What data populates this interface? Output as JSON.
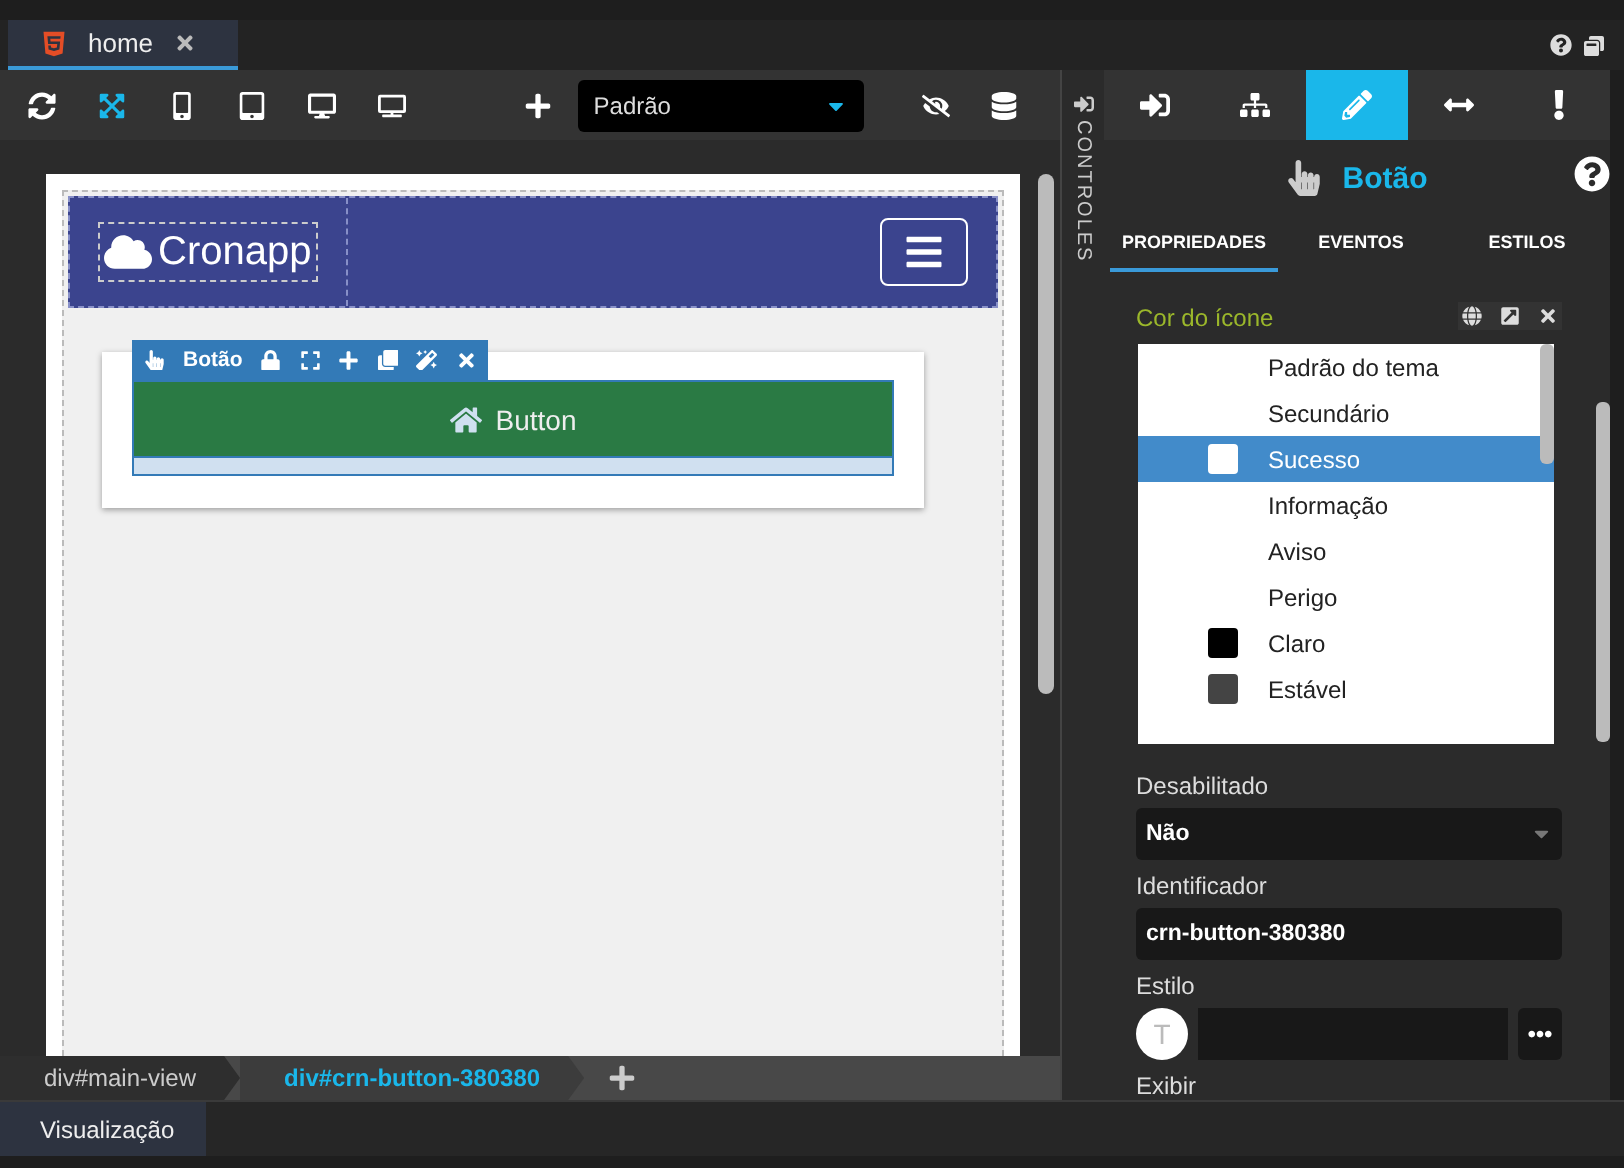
{
  "tabs": [
    {
      "label": "home",
      "selected": true
    }
  ],
  "toolbar": {
    "devices": [
      {
        "kind": "refresh",
        "selected": false
      },
      {
        "kind": "expand",
        "selected": true
      },
      {
        "kind": "phone",
        "selected": false
      },
      {
        "kind": "tablet",
        "selected": false
      },
      {
        "kind": "desktop",
        "selected": false
      },
      {
        "kind": "monitor",
        "selected": false
      }
    ],
    "theme_select": {
      "value": "Padrão"
    }
  },
  "canvas": {
    "navbar": {
      "logo": "Cronapp"
    },
    "selection_toolbar": {
      "label": "Botão"
    },
    "button": {
      "label": "Button"
    }
  },
  "breadcrumb": [
    {
      "label": "div#main-view",
      "selected": false
    },
    {
      "label": "div#crn-button-380380",
      "selected": true
    }
  ],
  "side_strip": {
    "label": "CONTROLES"
  },
  "bottom_tabs": [
    {
      "label": "Visualização",
      "selected": true
    }
  ],
  "panel": {
    "icon_tabs": [
      {
        "kind": "enter",
        "selected": false
      },
      {
        "kind": "tree",
        "selected": false
      },
      {
        "kind": "pencil",
        "selected": true
      },
      {
        "kind": "resize",
        "selected": false
      },
      {
        "kind": "exclaim",
        "selected": false
      }
    ],
    "title": "Botão",
    "subtabs": [
      {
        "label": "PROPRIEDADES",
        "selected": true
      },
      {
        "label": "EVENTOS",
        "selected": false
      },
      {
        "label": "ESTILOS",
        "selected": false
      }
    ],
    "icon_color": {
      "label": "Cor do ícone",
      "options": [
        {
          "label": "Padrão do tema",
          "selected": false
        },
        {
          "label": "Secundário",
          "selected": false
        },
        {
          "label": "Sucesso",
          "selected": true,
          "color": "#ffffff"
        },
        {
          "label": "Informação",
          "selected": false
        },
        {
          "label": "Aviso",
          "selected": false
        },
        {
          "label": "Perigo",
          "selected": false
        },
        {
          "label": "Claro",
          "selected": false,
          "color": "#000000"
        },
        {
          "label": "Estável",
          "selected": false,
          "color": "#444444"
        }
      ]
    },
    "fields": [
      {
        "kind": "select",
        "label": "Desabilitado",
        "value": "Não"
      },
      {
        "kind": "input",
        "label": "Identificador",
        "value": "crn-button-380380"
      },
      {
        "kind": "style",
        "label": "Estilo",
        "avatar": "T"
      },
      {
        "kind": "heading",
        "label": "Exibir"
      }
    ]
  }
}
